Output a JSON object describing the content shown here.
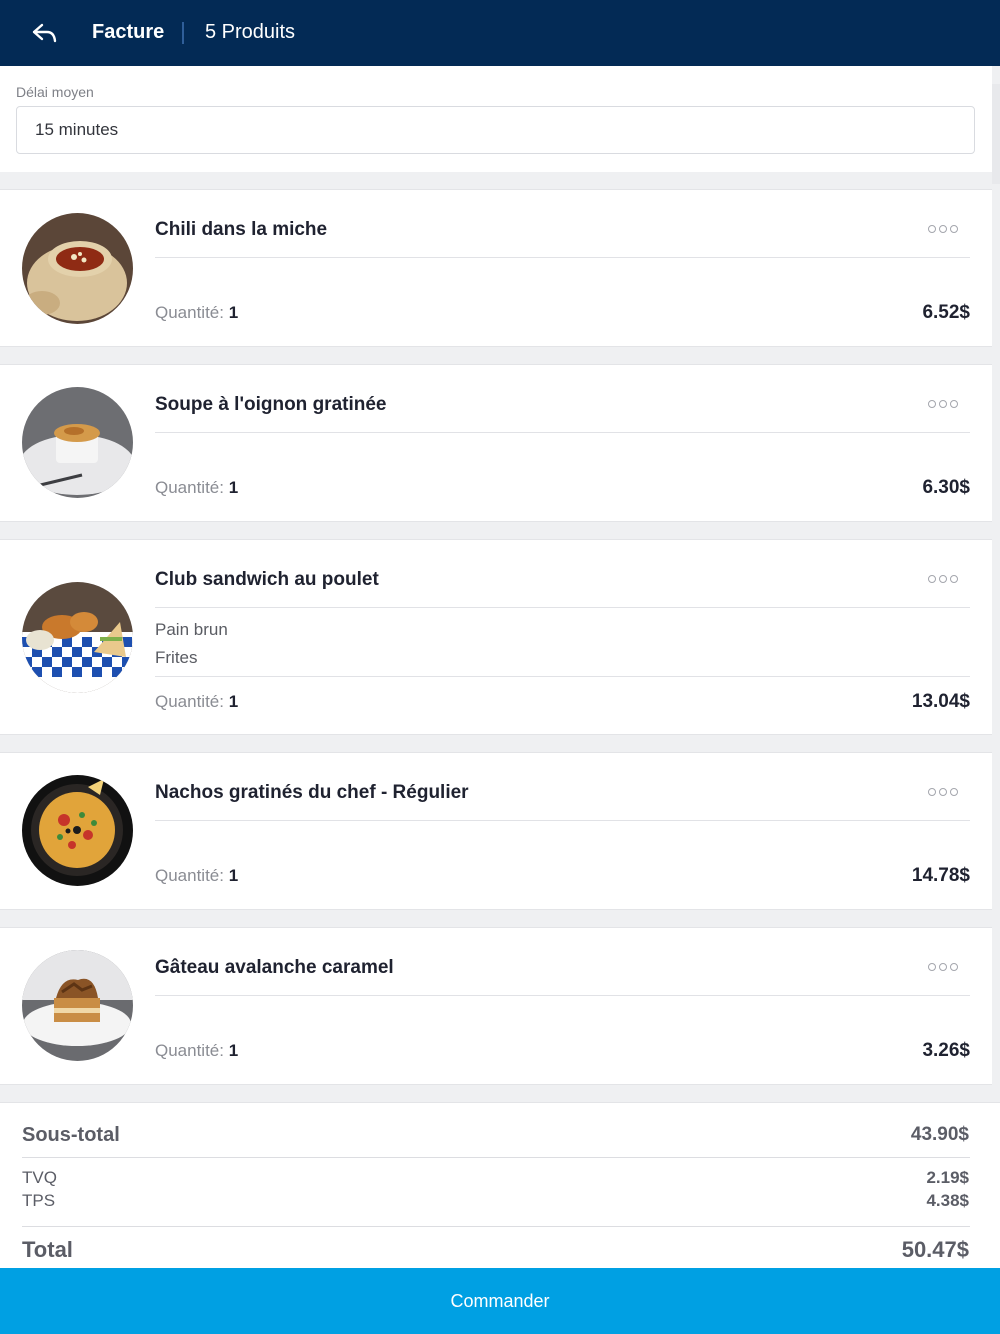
{
  "header": {
    "title": "Facture",
    "count_label": "5 Produits"
  },
  "delay": {
    "label": "Délai moyen",
    "value": "15 minutes"
  },
  "items": [
    {
      "name": "Chili dans la miche",
      "quantity_label": "Quantité:",
      "quantity": "1",
      "price": "6.52$",
      "options": [],
      "image_icon": "chili-bread-bowl-photo"
    },
    {
      "name": "Soupe à l'oignon gratinée",
      "quantity_label": "Quantité:",
      "quantity": "1",
      "price": "6.30$",
      "options": [],
      "image_icon": "onion-soup-photo"
    },
    {
      "name": "Club sandwich au poulet",
      "quantity_label": "Quantité:",
      "quantity": "1",
      "price": "13.04$",
      "options": [
        "Pain brun",
        "Frites"
      ],
      "image_icon": "club-sandwich-photo"
    },
    {
      "name": "Nachos gratinés du chef - Régulier",
      "quantity_label": "Quantité:",
      "quantity": "1",
      "price": "14.78$",
      "options": [],
      "image_icon": "nachos-photo"
    },
    {
      "name": "Gâteau avalanche caramel",
      "quantity_label": "Quantité:",
      "quantity": "1",
      "price": "3.26$",
      "options": [],
      "image_icon": "caramel-cake-photo"
    }
  ],
  "totals": {
    "subtotal_label": "Sous-total",
    "subtotal": "43.90$",
    "tvq_label": "TVQ",
    "tvq": "2.19$",
    "tps_label": "TPS",
    "tps": "4.38$",
    "total_label": "Total",
    "total": "50.47$"
  },
  "order_button": "Commander",
  "colors": {
    "header_bg": "#032a55",
    "accent": "#00a0e3",
    "page_bg": "#eff0f2"
  }
}
